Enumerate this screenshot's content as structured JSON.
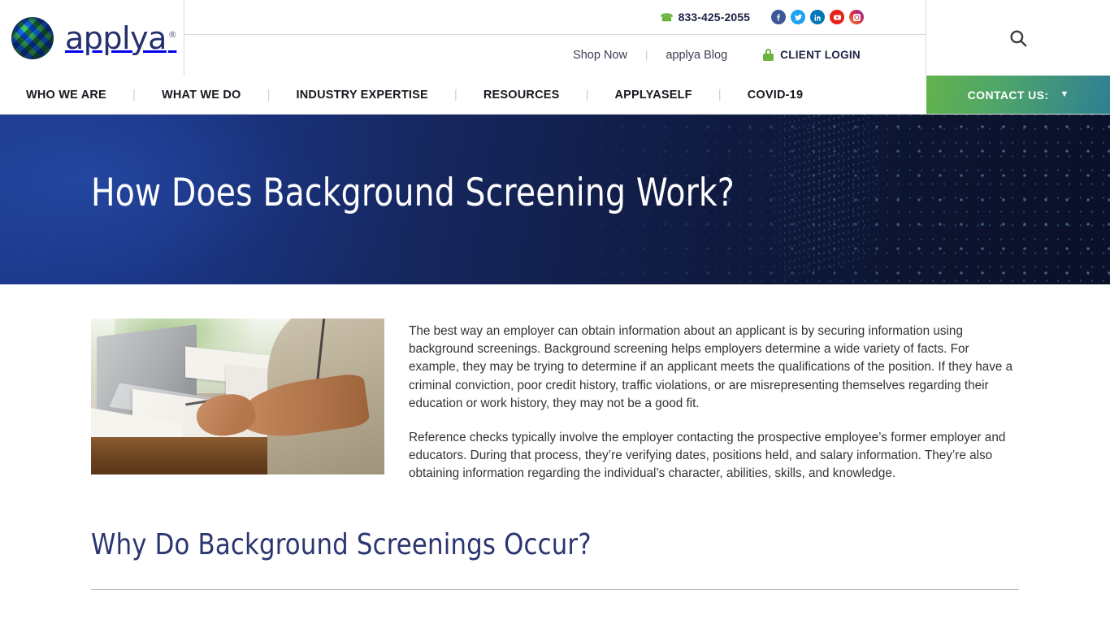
{
  "brand": {
    "name": "applya",
    "trademark": "®",
    "logo_icon": "globe-icon",
    "navy": "#23306b",
    "green": "#6cb33f",
    "teal": "#2f7f94"
  },
  "topbar": {
    "phone": "833-425-2055",
    "phone_icon": "phone-icon",
    "socials": [
      {
        "name": "facebook-icon",
        "label": "f",
        "color": "#3b5998"
      },
      {
        "name": "twitter-icon",
        "label": "t",
        "color": "#1da1f2"
      },
      {
        "name": "linkedin-icon",
        "label": "in",
        "color": "#0077b5"
      },
      {
        "name": "youtube-icon",
        "label": "▶",
        "color": "#e62117"
      },
      {
        "name": "instagram-icon",
        "label": "□",
        "color": "#dc2743"
      }
    ]
  },
  "utilbar": {
    "shop_now": "Shop Now",
    "separator": "|",
    "blog": "applya Blog",
    "client_login": "CLIENT LOGIN",
    "lock_icon": "lock-icon"
  },
  "search": {
    "icon": "search-icon",
    "label": "Search"
  },
  "nav": {
    "items": [
      {
        "label": "WHO WE ARE"
      },
      {
        "label": "WHAT WE DO"
      },
      {
        "label": "INDUSTRY EXPERTISE"
      },
      {
        "label": "RESOURCES"
      },
      {
        "label": "APPLYASELF"
      },
      {
        "label": "COVID-19"
      }
    ],
    "divider": "|",
    "contact": {
      "label": "CONTACT US:",
      "caret_icon": "chevron-down-icon"
    }
  },
  "hero": {
    "title": "How Does Background Screening Work?",
    "bg_start": "#1d3a8f",
    "bg_end": "#0a1129"
  },
  "article": {
    "image_alt": "person-at-desk-with-laptop-and-clipboard",
    "paragraphs": [
      "The best way an employer can obtain information about an applicant is by securing information using background screenings. Background screening helps employers determine a wide variety of facts. For example, they may be trying to determine if an applicant meets the qualifications of the position. If they have a criminal conviction, poor credit history, traffic violations, or are misrepresenting themselves regarding their education or work history, they may not be a good fit.",
      "Reference checks typically involve the employer contacting the prospective employee’s former employer and educators. During that process, they’re verifying dates, positions held, and salary information. They’re also obtaining information regarding the individual’s character, abilities, skills, and knowledge."
    ],
    "section_heading": "Why Do Background Screenings Occur?"
  }
}
